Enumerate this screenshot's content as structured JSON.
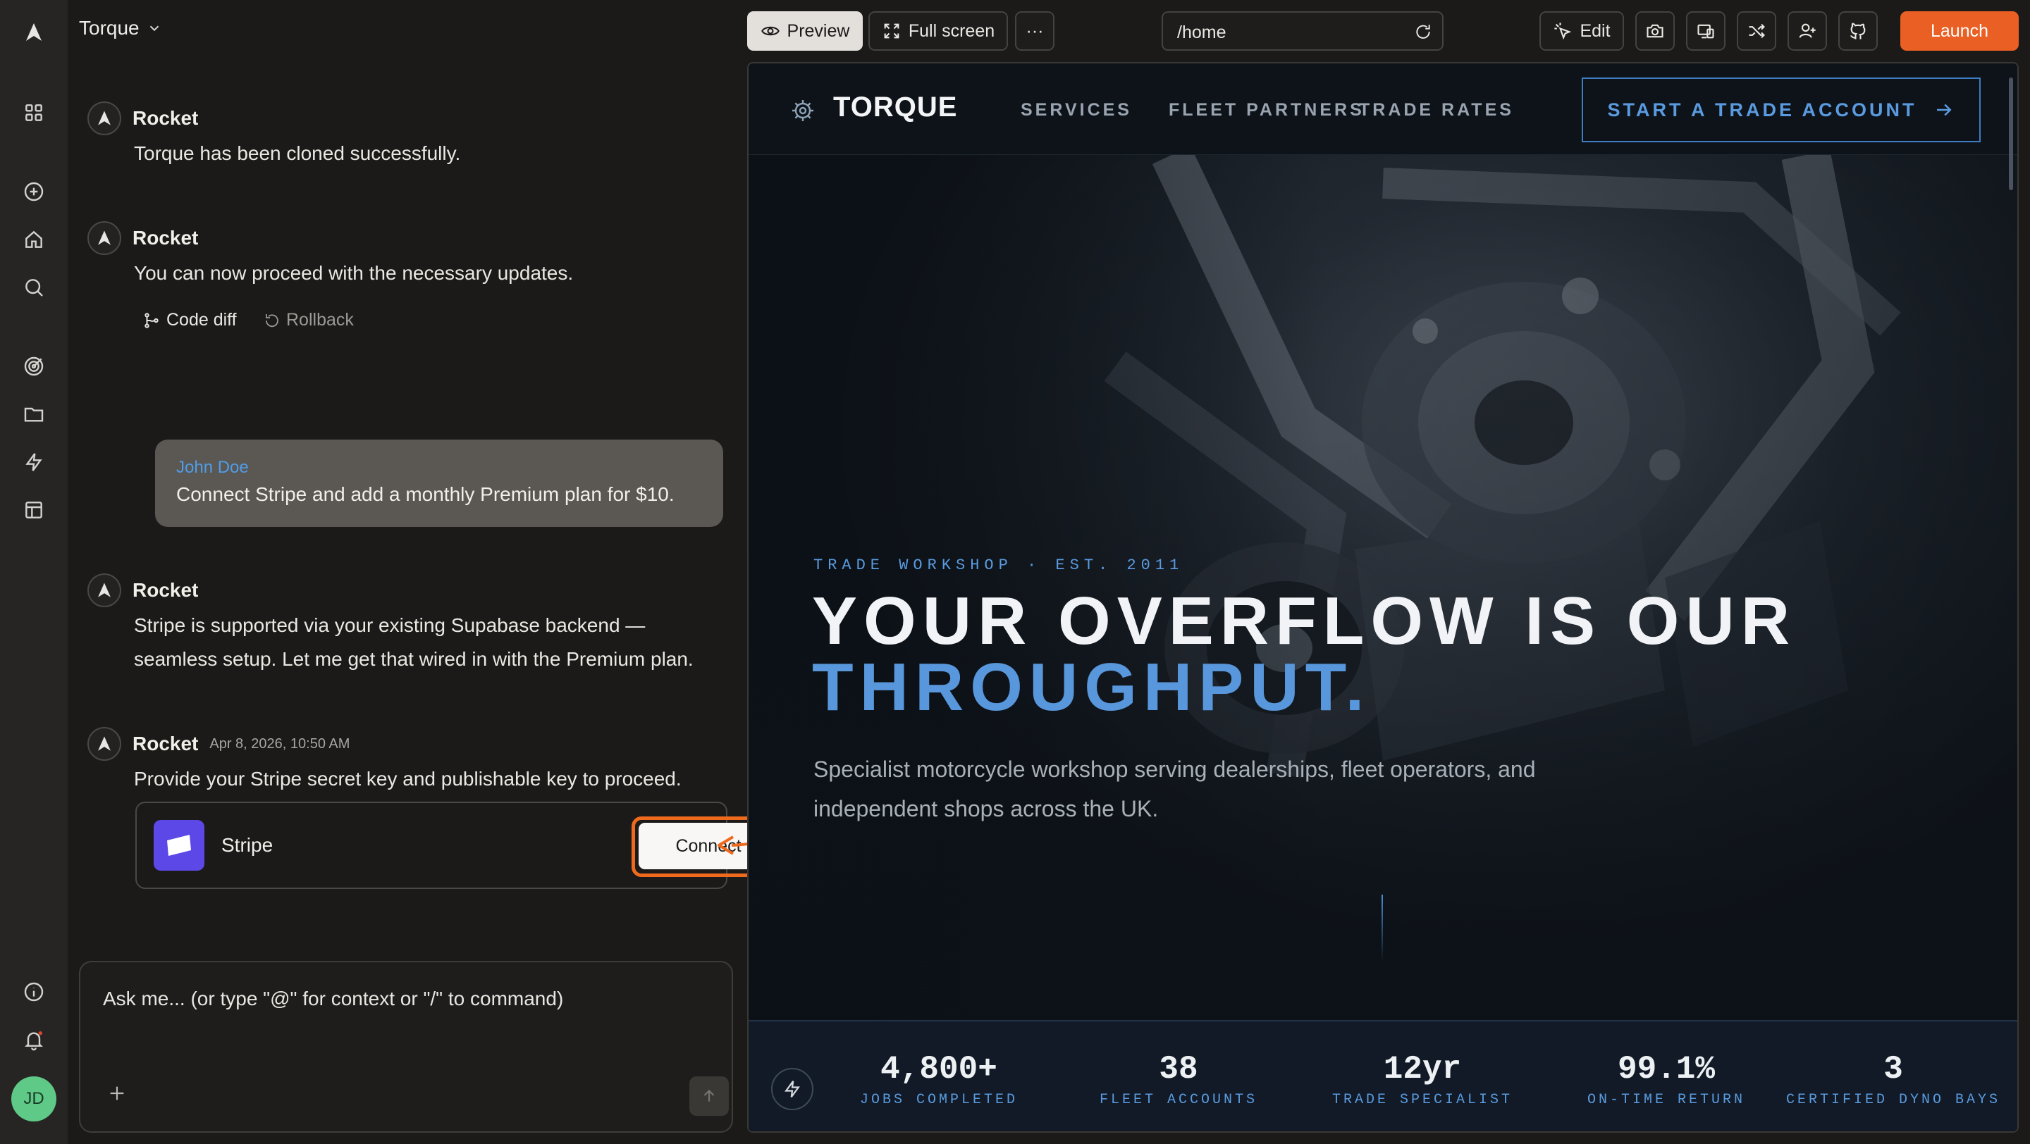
{
  "app": {
    "project_name": "Torque",
    "brand_color": "#ea5f23"
  },
  "rail": {
    "items": [
      "grid-icon",
      "plus-circle-icon",
      "home-icon",
      "search-icon",
      "target-icon",
      "folder-icon",
      "bolt-icon",
      "layout-icon",
      "info-icon",
      "bell-icon"
    ],
    "avatar_initials": "JD"
  },
  "chat": {
    "messages": [
      {
        "sender": "Rocket",
        "text": "Torque has been cloned successfully."
      },
      {
        "sender": "Rocket",
        "text": "You can now proceed with the necessary updates.",
        "actions": [
          "Code diff",
          "Rollback"
        ]
      },
      {
        "sender": "John Doe",
        "text": "Connect Stripe and add a monthly Premium plan for $10."
      },
      {
        "sender": "Rocket",
        "text_line1": "Stripe is supported via your existing Supabase backend —",
        "text_line2": "seamless setup. Let me get that wired in with the Premium plan."
      },
      {
        "sender": "Rocket",
        "timestamp": "Apr 8, 2026, 10:50 AM",
        "text": "Provide your Stripe secret key and publishable key to proceed."
      }
    ],
    "integration": {
      "name": "Stripe",
      "button": "Connect"
    },
    "composer_placeholder": "Ask me... (or type \"@\" for context or \"/\" to command)"
  },
  "toolbar": {
    "preview": "Preview",
    "fullscreen": "Full screen",
    "more": "···",
    "url": "/home",
    "edit": "Edit",
    "launch": "Launch"
  },
  "site": {
    "brand": "TORQUE",
    "nav": [
      "SERVICES",
      "FLEET PARTNERS",
      "TRADE RATES"
    ],
    "cta": "START A TRADE ACCOUNT",
    "eyebrow": "TRADE WORKSHOP · EST. 2011",
    "headline_1": "YOUR OVERFLOW IS OUR",
    "headline_2": "THROUGHPUT.",
    "subhead_line1": "Specialist motorcycle workshop serving dealerships, fleet operators, and",
    "subhead_line2": "independent shops across the UK.",
    "stats": [
      {
        "value": "4,800+",
        "label": "JOBS COMPLETED"
      },
      {
        "value": "38",
        "label": "FLEET ACCOUNTS"
      },
      {
        "value": "12yr",
        "label": "TRADE SPECIALIST"
      },
      {
        "value": "99.1%",
        "label": "ON-TIME RETURN"
      },
      {
        "value": "3",
        "label": "CERTIFIED DYNO BAYS"
      }
    ],
    "accent": "#5897db"
  }
}
